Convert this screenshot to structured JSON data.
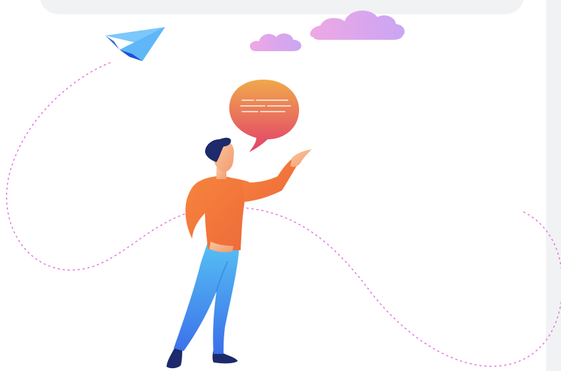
{
  "illustration": {
    "description_icons": [
      "paper-plane-icon",
      "cloud-icon",
      "speech-bubble-icon",
      "person-pointing-icon"
    ],
    "colors": {
      "panel": "#f1f2f4",
      "plane_light": "#5fb7f8",
      "plane_dark": "#1e5ee6",
      "cloud": "#d9a8f2",
      "bubble_top": "#f0a04a",
      "bubble_bottom": "#e2486a",
      "shirt": "#f27a3c",
      "jeans": "#4aa8f0",
      "hair": "#1d2a6b",
      "skin": "#f6b48a",
      "dashed_path": "#e46ee0"
    }
  }
}
